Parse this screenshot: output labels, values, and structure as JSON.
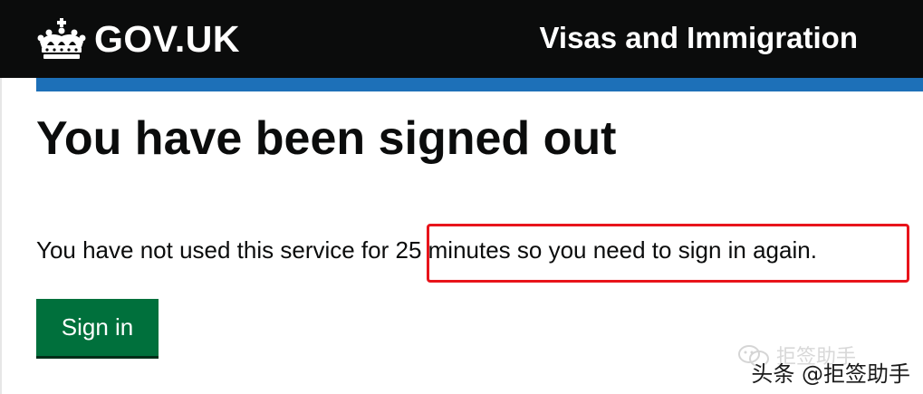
{
  "header": {
    "logo_text": "GOV.UK",
    "logo_icon": "crown-icon",
    "service_name": "Visas and Immigration",
    "background_color": "#0b0c0c",
    "accent_bar_color": "#1d70b8"
  },
  "main": {
    "title": "You have been signed out",
    "body_text": "You have not used this service for 25 minutes so you need to sign in again.",
    "sign_in_button_label": "Sign in",
    "button_color": "#00703c",
    "highlight_color": "#e8141b"
  },
  "watermark": {
    "ghost_text": "拒签助手",
    "main_text": "头条 @拒签助手",
    "icon": "wechat-icon"
  }
}
